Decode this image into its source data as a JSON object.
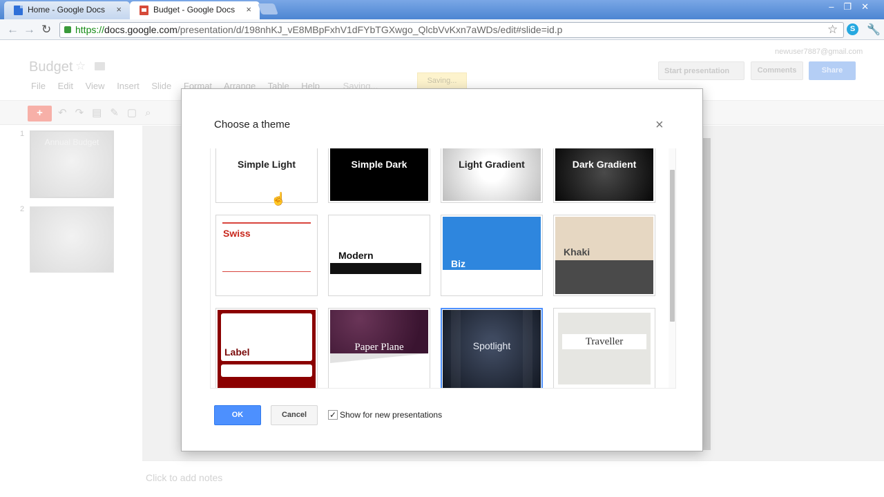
{
  "browser": {
    "tabs": [
      {
        "title": "Home - Google Docs",
        "icon": "docs-icon"
      },
      {
        "title": "Budget - Google Docs",
        "icon": "slides-icon"
      }
    ],
    "close_glyph": "×",
    "url": {
      "scheme": "https://",
      "host": "docs.google.com",
      "path": "/presentation/d/198nhKJ_vE8MBpFxhV1dFYbTGXwgo_QlcbVvKxn7aWDs/edit#slide=id.p"
    }
  },
  "app": {
    "doc_title": "Budget",
    "menu": [
      "File",
      "Edit",
      "View",
      "Insert",
      "Slide",
      "Format",
      "Arrange",
      "Table",
      "Help"
    ],
    "saving_inline": "Saving...",
    "saving_box": "Saving...",
    "user_email": "newuser7887@gmail.com",
    "start_presentation": "Start presentation",
    "comments": "Comments",
    "share": "Share",
    "slides": [
      {
        "number": "1",
        "title": "Annual Budget"
      },
      {
        "number": "2",
        "title": ""
      }
    ],
    "notes_placeholder": "Click to add notes"
  },
  "dialog": {
    "title": "Choose a theme",
    "close_glyph": "×",
    "themes": [
      {
        "name": "Simple Light"
      },
      {
        "name": "Simple Dark"
      },
      {
        "name": "Light Gradient"
      },
      {
        "name": "Dark Gradient"
      },
      {
        "name": "Swiss"
      },
      {
        "name": "Modern"
      },
      {
        "name": "Biz"
      },
      {
        "name": "Khaki"
      },
      {
        "name": "Label"
      },
      {
        "name": "Paper Plane"
      },
      {
        "name": "Spotlight",
        "selected": true
      },
      {
        "name": "Traveller"
      }
    ],
    "ok": "OK",
    "cancel": "Cancel",
    "show_for_new": {
      "label": "Show for new presentations",
      "checked": true
    }
  },
  "colors": {
    "accent_blue": "#4d90fe",
    "swiss_red": "#c8271c",
    "biz_blue": "#2e86de",
    "label_red": "#8b0000"
  }
}
